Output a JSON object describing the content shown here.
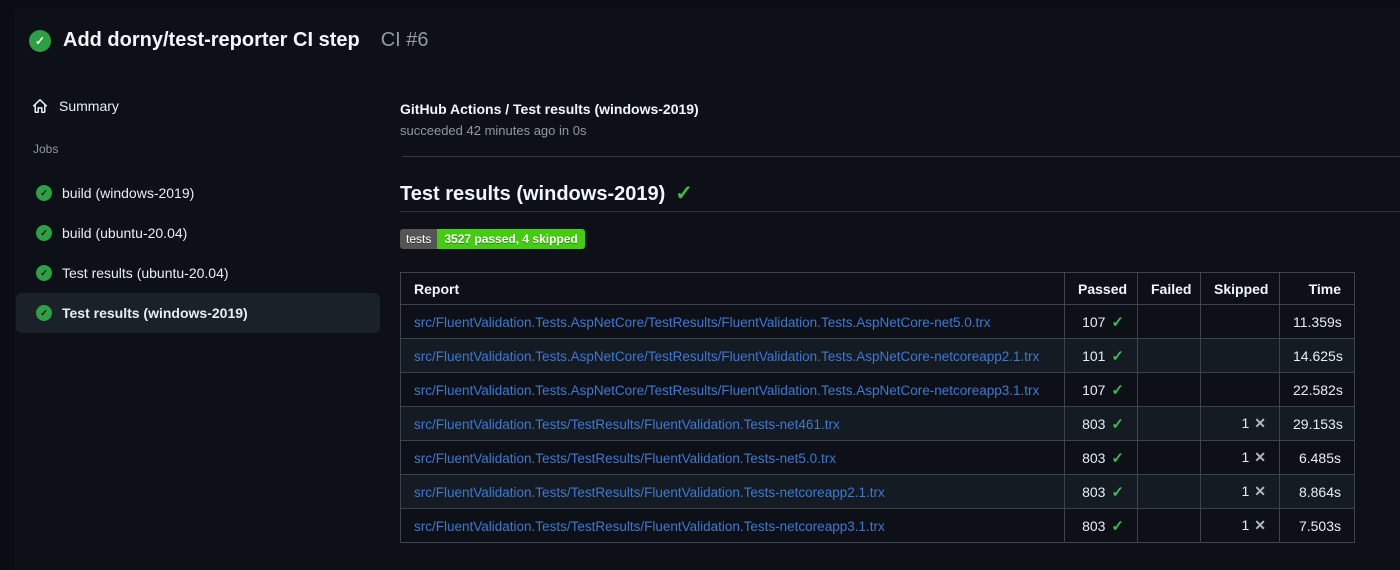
{
  "icons": {
    "check_glyph": "✓",
    "cross_glyph": "✕"
  },
  "colors": {
    "page_bg": "#0d1117",
    "success_green": "#2ea043",
    "check_green": "#3fb950",
    "link_blue": "#3a79d4",
    "badge_label_bg": "#555555",
    "badge_value_bg": "#44cc11",
    "muted_text": "#9198a1",
    "table_border": "#3d444d",
    "selected_item_bg": "#1b2129"
  },
  "header": {
    "title": "Add dorny/test-reporter CI step",
    "run_number": "CI #6"
  },
  "sidebar": {
    "summary_label": "Summary",
    "jobs_section_label": "Jobs",
    "jobs": [
      {
        "label": "build (windows-2019)",
        "selected": false
      },
      {
        "label": "build (ubuntu-20.04)",
        "selected": false
      },
      {
        "label": "Test results (ubuntu-20.04)",
        "selected": false
      },
      {
        "label": "Test results (windows-2019)",
        "selected": true
      }
    ]
  },
  "main": {
    "job_title": "GitHub Actions / Test results (windows-2019)",
    "job_status": "succeeded 42 minutes ago in 0s",
    "heading": "Test results (windows-2019)",
    "badge": {
      "label": "tests",
      "value": "3527 passed, 4 skipped"
    },
    "table": {
      "columns": [
        "Report",
        "Passed",
        "Failed",
        "Skipped",
        "Time"
      ],
      "rows": [
        {
          "report": "src/FluentValidation.Tests.AspNetCore/TestResults/FluentValidation.Tests.AspNetCore-net5.0.trx",
          "passed": "107",
          "failed": "",
          "skipped": "",
          "time": "11.359s"
        },
        {
          "report": "src/FluentValidation.Tests.AspNetCore/TestResults/FluentValidation.Tests.AspNetCore-netcoreapp2.1.trx",
          "passed": "101",
          "failed": "",
          "skipped": "",
          "time": "14.625s"
        },
        {
          "report": "src/FluentValidation.Tests.AspNetCore/TestResults/FluentValidation.Tests.AspNetCore-netcoreapp3.1.trx",
          "passed": "107",
          "failed": "",
          "skipped": "",
          "time": "22.582s"
        },
        {
          "report": "src/FluentValidation.Tests/TestResults/FluentValidation.Tests-net461.trx",
          "passed": "803",
          "failed": "",
          "skipped": "1",
          "time": "29.153s"
        },
        {
          "report": "src/FluentValidation.Tests/TestResults/FluentValidation.Tests-net5.0.trx",
          "passed": "803",
          "failed": "",
          "skipped": "1",
          "time": "6.485s"
        },
        {
          "report": "src/FluentValidation.Tests/TestResults/FluentValidation.Tests-netcoreapp2.1.trx",
          "passed": "803",
          "failed": "",
          "skipped": "1",
          "time": "8.864s"
        },
        {
          "report": "src/FluentValidation.Tests/TestResults/FluentValidation.Tests-netcoreapp3.1.trx",
          "passed": "803",
          "failed": "",
          "skipped": "1",
          "time": "7.503s"
        }
      ]
    }
  }
}
